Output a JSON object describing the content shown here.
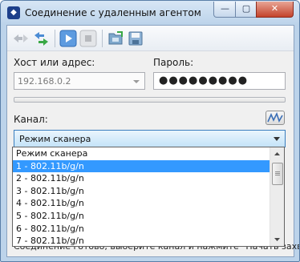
{
  "window": {
    "title": "Соединение с удаленным агентом",
    "minimize_label": "—",
    "maximize_label": "▢",
    "close_label": "✕"
  },
  "toolbar": {
    "buttons": [
      "connect-icon",
      "transfer-icon",
      "play-icon",
      "stop-icon",
      "network-folder-icon",
      "save-network-icon"
    ]
  },
  "form": {
    "host_label": "Хост или адрес:",
    "host_value": "192.168.0.2",
    "password_label": "Пароль:",
    "password_value": "●●●●●●●●●",
    "channel_label": "Канал:",
    "channel_value": "Режим сканера",
    "progress_fraction": 0
  },
  "dropdown": {
    "options": [
      "Режим сканера",
      "1 - 802.11b/g/n",
      "2 - 802.11b/g/n",
      "3 - 802.11b/g/n",
      "4 - 802.11b/g/n",
      "5 - 802.11b/g/n",
      "6 - 802.11b/g/n",
      "7 - 802.11b/g/n"
    ],
    "selected_index": 1
  },
  "status": {
    "text": "Соединение готово, выберите канал и нажмите \"Начать захват\""
  },
  "colors": {
    "selection": "#3399ff",
    "titlebar": "#bcd3ea",
    "close": "#c4432b"
  }
}
